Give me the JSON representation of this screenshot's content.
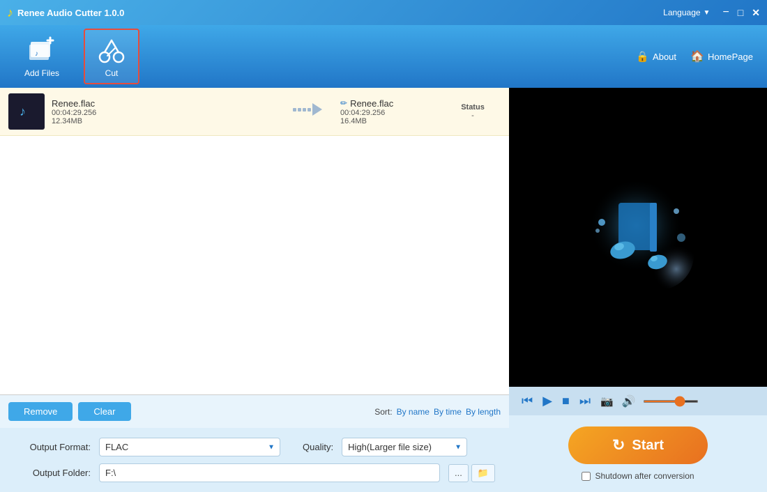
{
  "app": {
    "title": "Renee Audio Cutter 1.0.0",
    "logo_char": "♪"
  },
  "titlebar": {
    "language_label": "Language",
    "dropdown_char": "▼",
    "minimize_char": "−",
    "maximize_char": "□",
    "close_char": "✕"
  },
  "toolbar": {
    "add_files_label": "Add Files",
    "cut_label": "Cut",
    "about_label": "About",
    "homepage_label": "HomePage"
  },
  "file_list": {
    "columns": [
      "",
      "",
      "",
      "Status"
    ],
    "rows": [
      {
        "source_name": "Renee.flac",
        "source_duration": "00:04:29.256",
        "source_size": "12.34MB",
        "output_name": "Renee.flac",
        "output_duration": "00:04:29.256",
        "output_size": "16.4MB",
        "status_label": "Status",
        "status_value": "-"
      }
    ]
  },
  "controls": {
    "remove_label": "Remove",
    "clear_label": "Clear",
    "sort_label": "Sort:",
    "sort_by_name": "By name",
    "sort_by_time": "By time",
    "sort_by_length": "By length"
  },
  "output_settings": {
    "format_label": "Output Format:",
    "format_value": "FLAC",
    "quality_label": "Quality:",
    "quality_value": "High(Larger file size)",
    "folder_label": "Output Folder:",
    "folder_value": "F:\\",
    "browse_btn": "...",
    "open_btn": "🗀"
  },
  "player": {
    "skip_back_char": "⏮",
    "play_char": "▶",
    "stop_char": "■",
    "skip_fwd_char": "⏭",
    "camera_char": "📷",
    "volume_char": "🔊",
    "volume_percent": 70
  },
  "start_section": {
    "start_label": "Start",
    "refresh_char": "↺",
    "shutdown_label": "Shutdown after conversion"
  },
  "colors": {
    "primary_blue": "#2176c7",
    "light_blue": "#3fa8e8",
    "orange": "#e87020",
    "file_row_bg": "#fef9e7"
  }
}
